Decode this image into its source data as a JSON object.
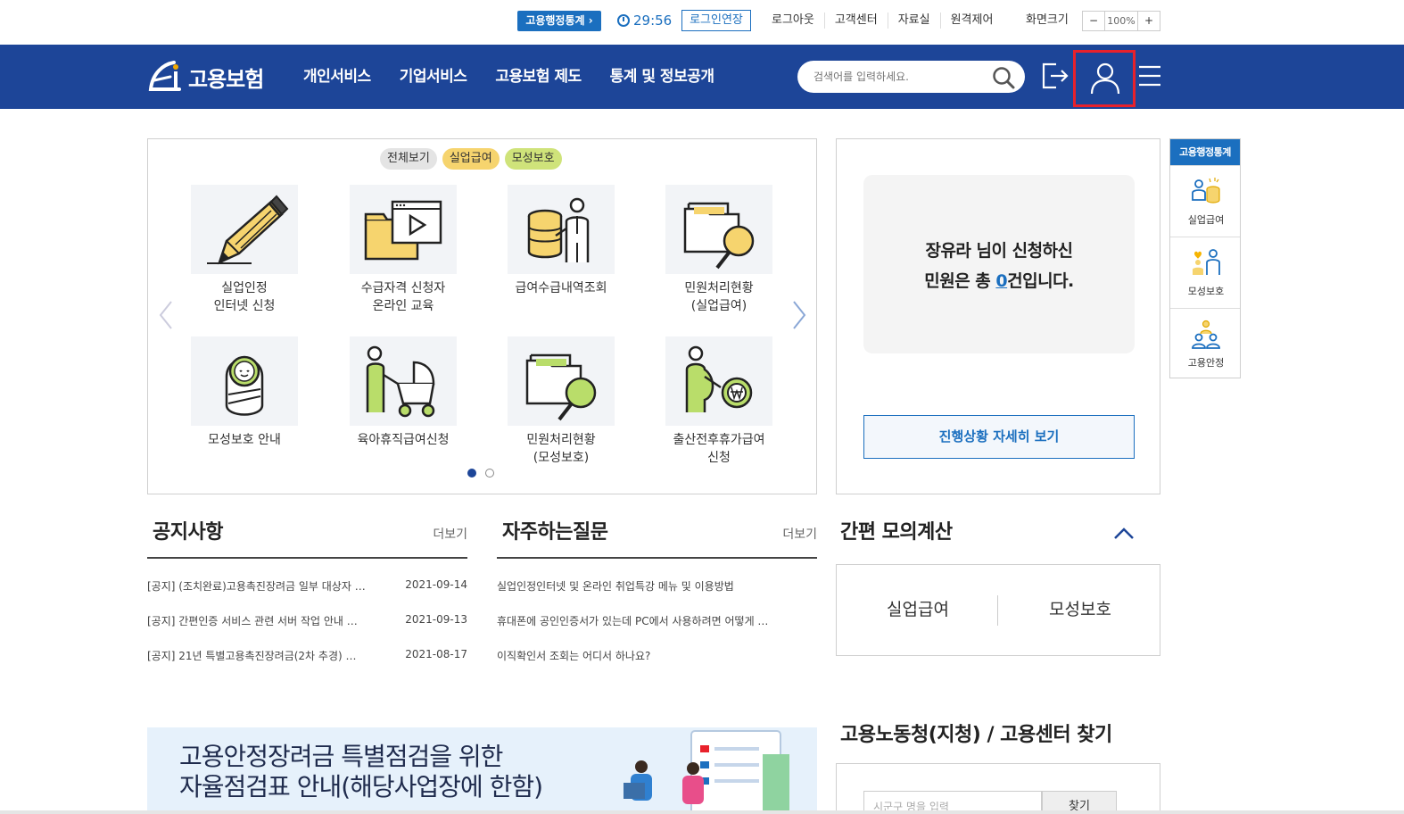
{
  "utility": {
    "stats_button": "고용행정통계 ›",
    "timer": "29:56",
    "extend_login": "로그인연장",
    "links": [
      "로그아웃",
      "고객센터",
      "자료실",
      "원격제어"
    ],
    "zoom_label": "화면크기",
    "zoom_minus": "−",
    "zoom_value": "100%",
    "zoom_plus": "+"
  },
  "header": {
    "logo_text": "고용보험",
    "nav": [
      "개인서비스",
      "기업서비스",
      "고용보험 제도",
      "통계 및 정보공개"
    ],
    "search_placeholder": "검색어를 입력하세요."
  },
  "services": {
    "chips": [
      "전체보기",
      "실업급여",
      "모성보호"
    ],
    "items": [
      {
        "label": "실업인정\n인터넷 신청",
        "icon": "pencil-icon"
      },
      {
        "label": "수급자격 신청자\n온라인 교육",
        "icon": "video-folder-icon"
      },
      {
        "label": "급여수급내역조회",
        "icon": "coins-person-icon"
      },
      {
        "label": "민원처리현황\n(실업급여)",
        "icon": "folder-search-icon"
      },
      {
        "label": "모성보호 안내",
        "icon": "baby-icon"
      },
      {
        "label": "육아휴직급여신청",
        "icon": "stroller-icon"
      },
      {
        "label": "민원처리현황\n(모성보호)",
        "icon": "folder-search-icon"
      },
      {
        "label": "출산전후휴가급여\n신청",
        "icon": "pregnant-won-icon"
      }
    ]
  },
  "status": {
    "line1": "장유라 님이 신청하신",
    "line2_prefix": "민원은 총 ",
    "count": "0",
    "line2_suffix": "건입니다.",
    "detail_button": "진행상황 자세히 보기"
  },
  "quick": {
    "title": "고용행정통계",
    "items": [
      "실업급여",
      "모성보호",
      "고용안정"
    ]
  },
  "notice": {
    "title": "공지사항",
    "more": "더보기",
    "rows": [
      {
        "title": "[공지] (조치완료)고용촉진장려금 일부 대상자 …",
        "date": "2021-09-14"
      },
      {
        "title": "[공지] 간편인증 서비스 관련 서버 작업 안내 …",
        "date": "2021-09-13"
      },
      {
        "title": "[공지] 21년 특별고용촉진장려금(2차 추경) …",
        "date": "2021-08-17"
      }
    ]
  },
  "faq": {
    "title": "자주하는질문",
    "more": "더보기",
    "rows": [
      "실업인정인터넷 및 온라인 취업특강 메뉴 및 이용방법",
      "휴대폰에 공인인증서가 있는데 PC에서 사용하려면 어떻게 …",
      "이직확인서 조회는 어디서 하나요?"
    ]
  },
  "calc": {
    "title": "간편 모의계산",
    "items": [
      "실업급여",
      "모성보호"
    ]
  },
  "banner": {
    "line1": "고용안정장려금 특별점검을 위한",
    "line2": "자율점검표 안내(해당사업장에 한함)"
  },
  "office": {
    "title": "고용노동청(지청) / 고용센터 찾기",
    "placeholder": "시군구 명을 입력",
    "button": "찾기"
  },
  "colors": {
    "header_bg": "#1d4598",
    "accent": "#1b6fbf",
    "highlight": "#e8212b"
  }
}
